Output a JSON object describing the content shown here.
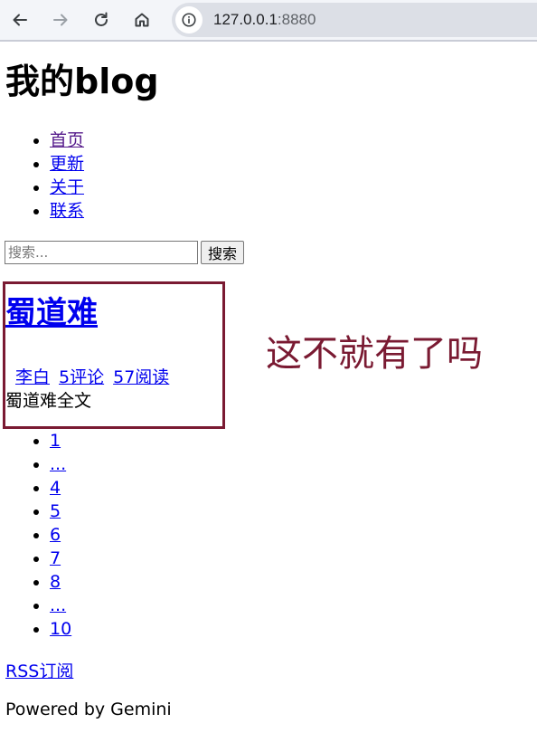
{
  "browser": {
    "url_host": "127.0.0.1",
    "url_port": ":8880"
  },
  "site": {
    "title": "我的blog"
  },
  "nav": {
    "items": [
      {
        "label": "首页"
      },
      {
        "label": "更新"
      },
      {
        "label": "关于"
      },
      {
        "label": "联系"
      }
    ]
  },
  "search": {
    "placeholder": "搜索...",
    "button_label": "搜索"
  },
  "post": {
    "title": "蜀道难",
    "author": "李白",
    "comments": "5评论",
    "views": "57阅读",
    "excerpt": "蜀道难全文"
  },
  "annotation": {
    "text": "这不就有了吗",
    "color": "#7a1a32"
  },
  "pagination": {
    "items": [
      "1",
      "...",
      "4",
      "5",
      "6",
      "7",
      "8",
      "...",
      "10"
    ]
  },
  "footer": {
    "rss_label": "RSS订阅",
    "powered_by": "Powered by Gemini"
  }
}
